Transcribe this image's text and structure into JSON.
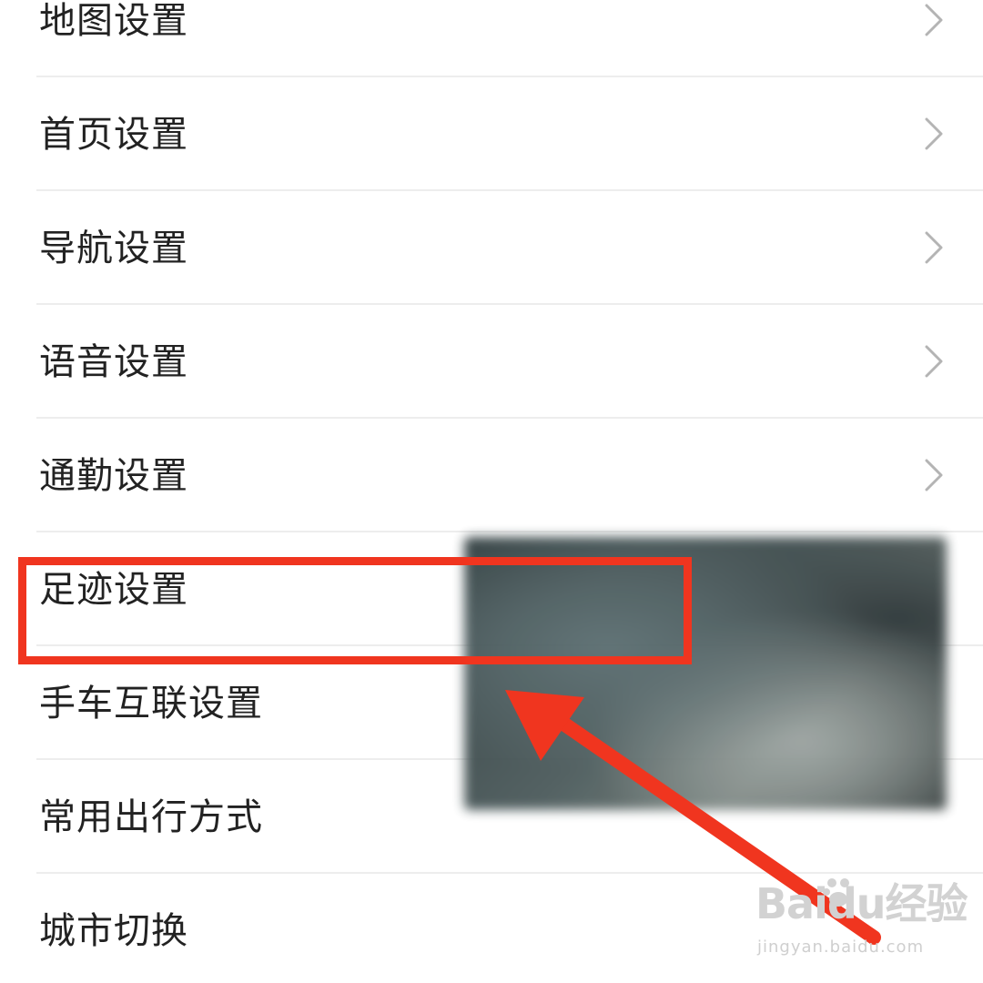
{
  "settings": {
    "items": [
      {
        "label": "地图设置",
        "has_chevron": true
      },
      {
        "label": "首页设置",
        "has_chevron": true
      },
      {
        "label": "导航设置",
        "has_chevron": true
      },
      {
        "label": "语音设置",
        "has_chevron": true
      },
      {
        "label": "通勤设置",
        "has_chevron": true
      },
      {
        "label": "足迹设置",
        "has_chevron": false
      },
      {
        "label": "手车互联设置",
        "has_chevron": false
      },
      {
        "label": "常用出行方式",
        "has_chevron": false
      },
      {
        "label": "城市切换",
        "has_chevron": false
      }
    ]
  },
  "annotation": {
    "highlight_color": "#f0351f",
    "highlighted_item": "足迹设置"
  },
  "watermark": {
    "brand": "Baidu经验",
    "url": "jingyan.baidu.com"
  },
  "icons": {
    "chevron": "chevron-right-icon",
    "arrow": "red-arrow-annotation",
    "paw": "baidu-paw-icon"
  }
}
